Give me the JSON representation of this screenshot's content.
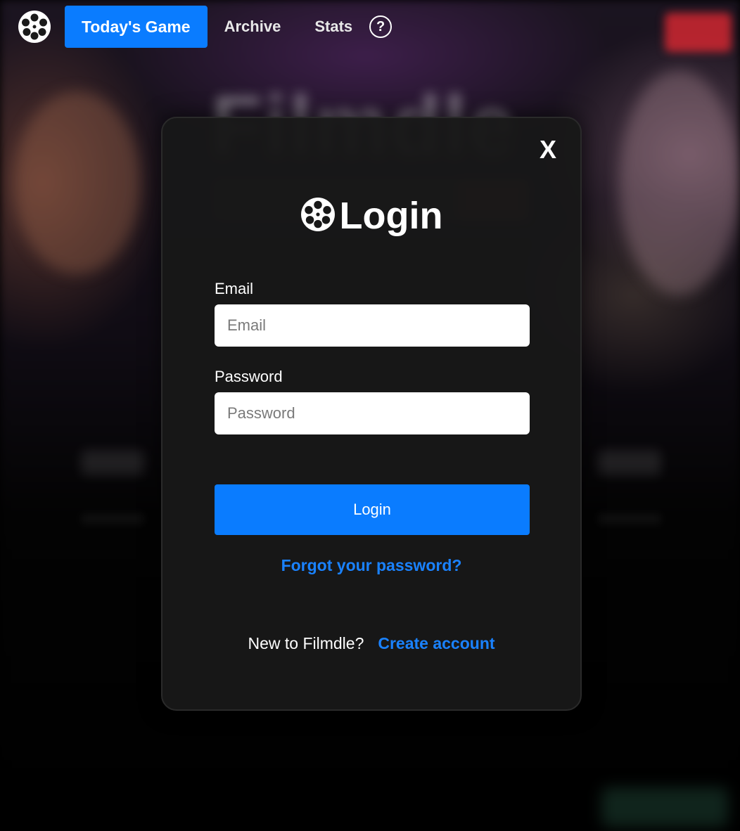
{
  "nav": {
    "logo_icon": "film-reel-icon",
    "items": [
      {
        "label": "Today's Game",
        "active": true
      },
      {
        "label": "Archive",
        "active": false
      },
      {
        "label": "Stats",
        "active": false
      }
    ],
    "help_icon": "question-circle-icon",
    "help_glyph": "?"
  },
  "modal": {
    "close_label": "X",
    "title_icon": "film-reel-icon",
    "title": "Login",
    "email": {
      "label": "Email",
      "placeholder": "Email",
      "value": ""
    },
    "password": {
      "label": "Password",
      "placeholder": "Password",
      "value": ""
    },
    "submit_label": "Login",
    "forgot_label": "Forgot your password?",
    "signup_prompt": "New to Filmdle?",
    "signup_link": "Create account"
  },
  "colors": {
    "accent": "#0a7cff",
    "link": "#1a82ff",
    "modal_bg": "#181818",
    "page_bg": "#000000"
  }
}
